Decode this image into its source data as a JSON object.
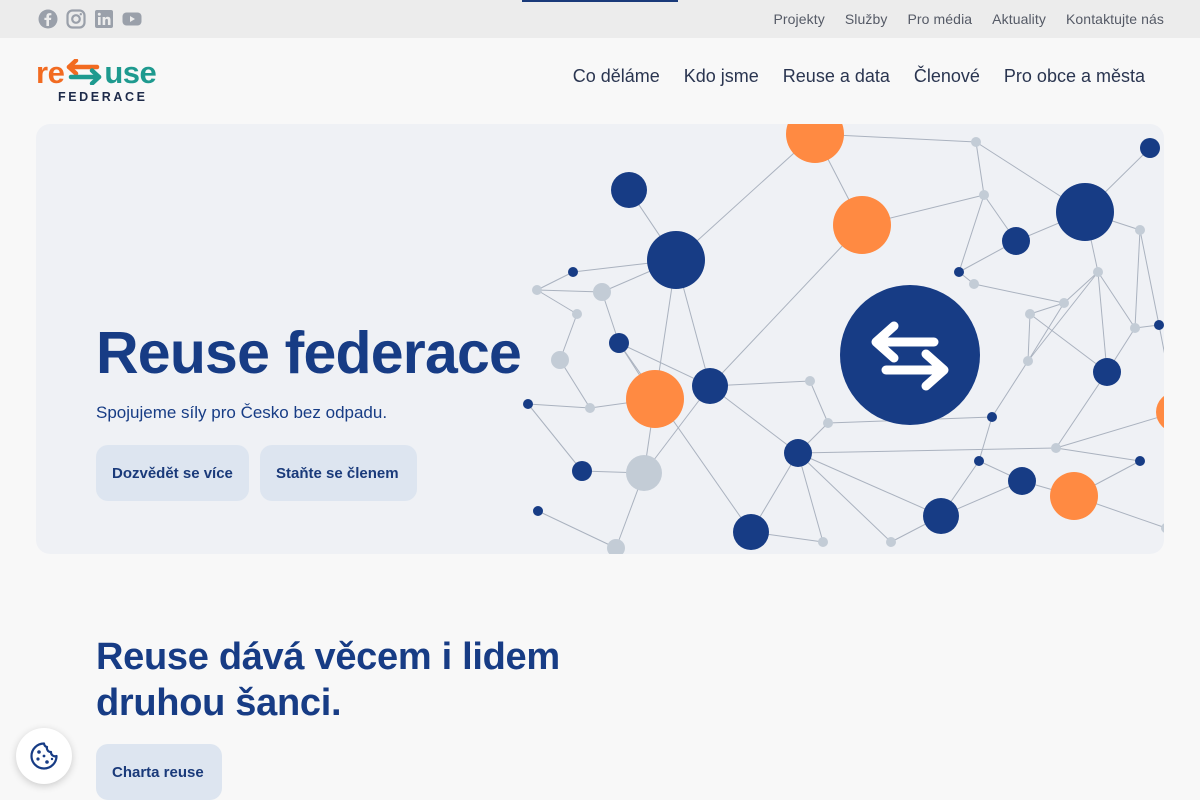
{
  "topbar": {
    "socials": [
      {
        "icon": "facebook-icon"
      },
      {
        "icon": "instagram-icon"
      },
      {
        "icon": "linkedin-icon"
      },
      {
        "icon": "youtube-icon"
      }
    ],
    "links": [
      "Projekty",
      "Služby",
      "Pro média",
      "Aktuality",
      "Kontaktujte nás"
    ]
  },
  "logo": {
    "word_left": "re",
    "word_right": "use",
    "subtitle": "FEDERACE",
    "colors": {
      "orange": "#f26b21",
      "teal": "#1e9a8f",
      "dark": "#1e2b4a"
    }
  },
  "nav": {
    "items": [
      "Co děláme",
      "Kdo jsme",
      "Reuse a data",
      "Členové",
      "Pro obce a města"
    ]
  },
  "hero": {
    "title": "Reuse federace",
    "subtitle": "Spojujeme síly pro Česko bez odpadu.",
    "primary_button": "Dozvědět se více",
    "secondary_button": "Staňte se členem",
    "illustration_icon": "exchange-arrows-icon"
  },
  "section": {
    "title_line1": "Reuse dává věcem i lidem",
    "title_line2": "druhou šanci.",
    "button": "Charta reuse"
  },
  "cookie": {
    "icon": "cookie-icon"
  },
  "colors": {
    "navy": "#173c85",
    "orange": "#ff8a42",
    "light_gray_node": "#c3ccd6",
    "button_bg": "#dde5f0"
  }
}
